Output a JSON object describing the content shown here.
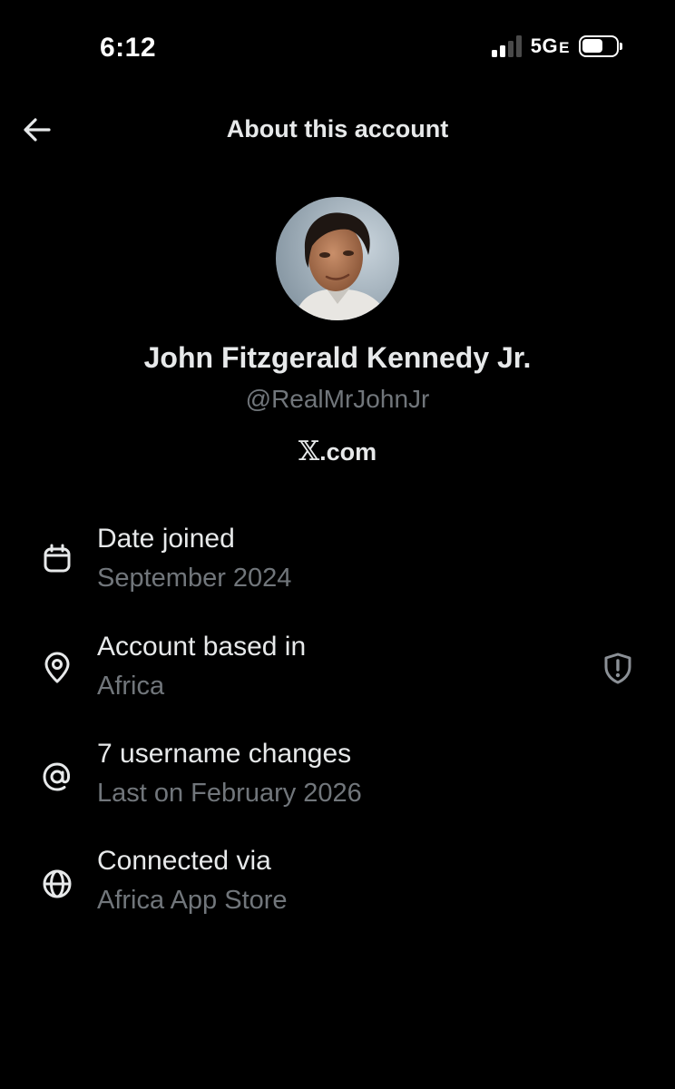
{
  "status_bar": {
    "time": "6:12",
    "network": "5G",
    "network_suffix": "E"
  },
  "header": {
    "title": "About this account",
    "back_icon": "arrow-left-icon"
  },
  "profile": {
    "name": "John Fitzgerald Kennedy Jr.",
    "handle": "@RealMrJohnJr",
    "site_logo": "𝕏",
    "site_suffix": ".com"
  },
  "details": [
    {
      "icon": "calendar-icon",
      "title": "Date joined",
      "value": "September 2024"
    },
    {
      "icon": "location-pin-icon",
      "title": "Account based in",
      "value": "Africa",
      "badge_icon": "shield-alert-icon"
    },
    {
      "icon": "at-sign-icon",
      "title": "7 username changes",
      "value": "Last on February 2026"
    },
    {
      "icon": "globe-icon",
      "title": "Connected via",
      "value": "Africa App Store"
    }
  ],
  "colors": {
    "background": "#000000",
    "primary_text": "#e7e9ea",
    "secondary_text": "#71767b"
  }
}
